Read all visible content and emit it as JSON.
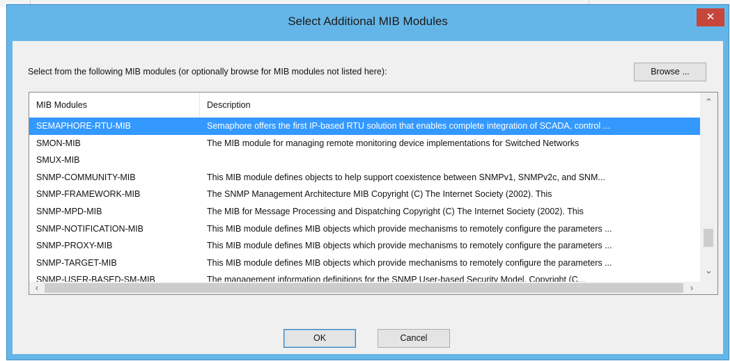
{
  "dialog": {
    "title": "Select Additional MIB Modules",
    "close_label": "✕",
    "instruction": "Select from the following MIB modules (or optionally browse for MIB modules not listed here):",
    "browse_label": "Browse ...",
    "ok_label": "OK",
    "cancel_label": "Cancel"
  },
  "list": {
    "columns": [
      "MIB Modules",
      "Description"
    ],
    "rows": [
      {
        "name": "SEMAPHORE-RTU-MIB",
        "description": "Semaphore offers the first IP-based RTU solution that enables complete integration of SCADA, control ...",
        "selected": true
      },
      {
        "name": "SMON-MIB",
        "description": "The MIB module for managing remote monitoring device implementations for Switched Networks"
      },
      {
        "name": "SMUX-MIB",
        "description": ""
      },
      {
        "name": "SNMP-COMMUNITY-MIB",
        "description": "This MIB module defines objects to help support coexistence between SNMPv1, SNMPv2c, and SNM..."
      },
      {
        "name": "SNMP-FRAMEWORK-MIB",
        "description": "The SNMP Management Architecture MIB Copyright (C) The Internet Society (2002). This"
      },
      {
        "name": "SNMP-MPD-MIB",
        "description": "The MIB for Message Processing and Dispatching Copyright (C) The Internet Society (2002). This"
      },
      {
        "name": "SNMP-NOTIFICATION-MIB",
        "description": "This MIB module defines MIB objects which provide mechanisms to remotely configure the parameters ..."
      },
      {
        "name": "SNMP-PROXY-MIB",
        "description": "This MIB module defines MIB objects which provide mechanisms to remotely configure the parameters ..."
      },
      {
        "name": "SNMP-TARGET-MIB",
        "description": "This MIB module defines MIB objects which provide mechanisms to remotely configure the parameters ..."
      },
      {
        "name": "SNMP-USER-BASED-SM-MIB",
        "description": "The management information definitions for the SNMP User-based Security Model. Copyright (C..."
      }
    ],
    "scrollbar": {
      "up": "^",
      "down": "v",
      "left": "<",
      "right": ">"
    }
  }
}
